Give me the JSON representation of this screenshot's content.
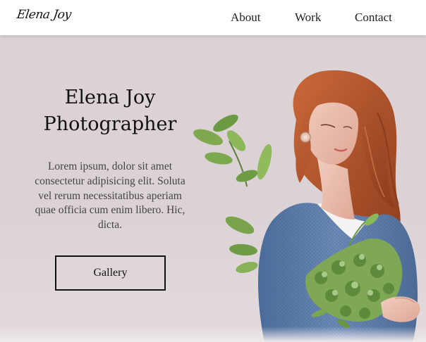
{
  "header": {
    "logo": "Elena Joy",
    "nav": [
      {
        "label": "About"
      },
      {
        "label": "Work"
      },
      {
        "label": "Contact"
      }
    ]
  },
  "hero": {
    "title_line1": "Elena Joy",
    "title_line2": "Photographer",
    "description": "Lorem ipsum, dolor sit amet consectetur adipisicing elit. Soluta vel rerum necessitatibus aperiam quae officia cum enim libero. Hic, dicta.",
    "button_label": "Gallery"
  },
  "colors": {
    "hero_background": "#dcd3d7",
    "text": "#111111",
    "sweater": "#5b7aa6",
    "hair": "#b5552a",
    "foliage": "#6d9a45"
  }
}
